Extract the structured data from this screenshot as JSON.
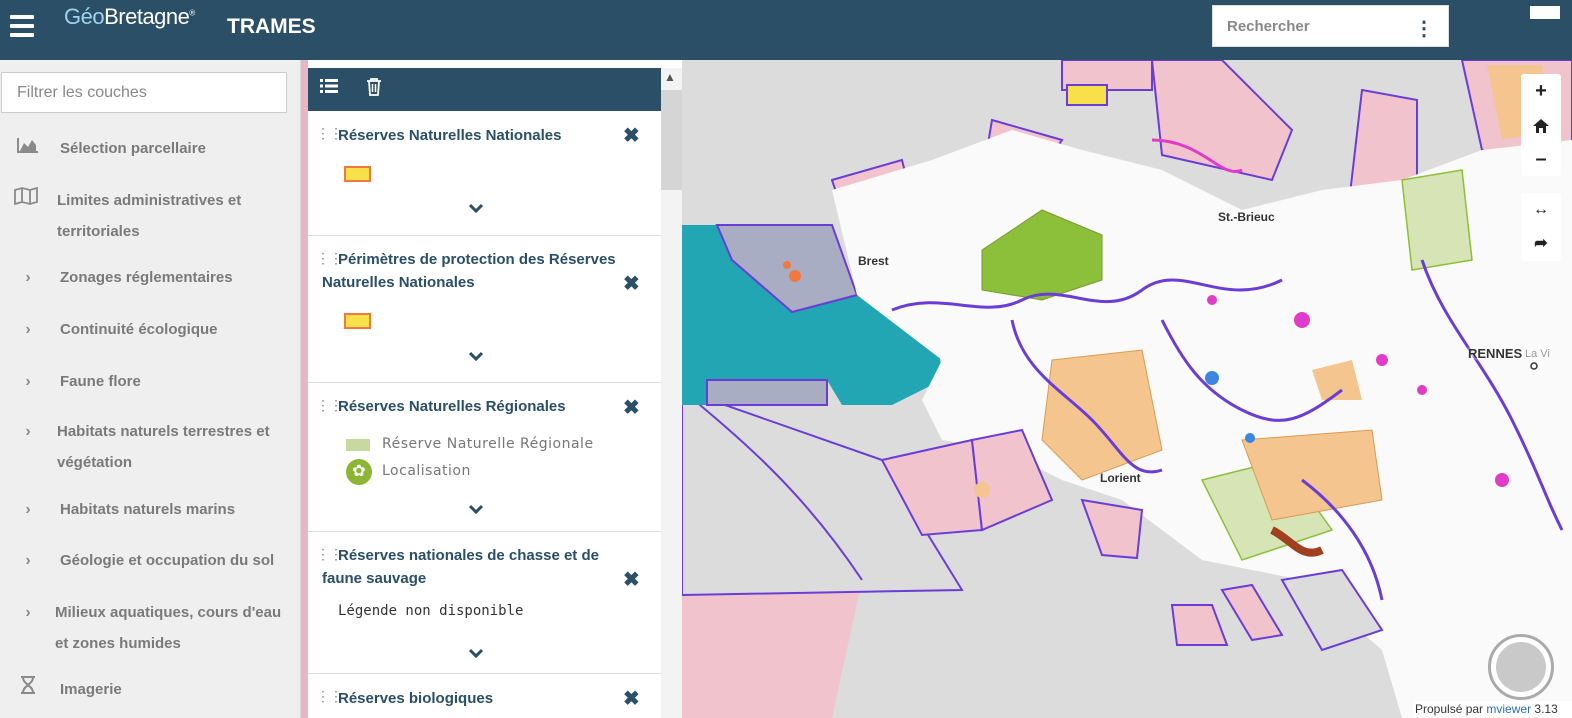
{
  "header": {
    "logo_geo": "Géo",
    "logo_bretagne": "Bretagne",
    "logo_reg": "®",
    "title": "TRAMES",
    "search_placeholder": "Rechercher"
  },
  "sidebar": {
    "filter_placeholder": "Filtrer les couches",
    "items": [
      {
        "label": "Sélection parcellaire",
        "icon": "area-chart-icon"
      },
      {
        "label": "Limites administratives et territoriales",
        "icon": "map-icon"
      },
      {
        "label": "Zonages réglementaires",
        "icon": "chevron-right-icon"
      },
      {
        "label": "Continuité écologique",
        "icon": "chevron-right-icon"
      },
      {
        "label": "Faune flore",
        "icon": "chevron-right-icon"
      },
      {
        "label": "Habitats naturels terrestres et végétation",
        "icon": "chevron-right-icon"
      },
      {
        "label": "Habitats naturels marins",
        "icon": "chevron-right-icon"
      },
      {
        "label": "Géologie et occupation du sol",
        "icon": "chevron-right-icon"
      },
      {
        "label": "Milieux aquatiques, cours d'eau et zones humides",
        "icon": "chevron-right-icon"
      },
      {
        "label": "Imagerie",
        "icon": "hourglass-icon"
      }
    ]
  },
  "layers": [
    {
      "title": "Réserves Naturelles Nationales"
    },
    {
      "title": "Périmètres de protection des Réserves Naturelles Nationales"
    },
    {
      "title": "Réserves Naturelles Régionales",
      "legend": [
        "Réserve Naturelle Régionale",
        "Localisation"
      ]
    },
    {
      "title": "Réserves nationales de chasse et de faune sauvage",
      "no_legend": "Légende non disponible"
    },
    {
      "title": "Réserves biologiques"
    }
  ],
  "map": {
    "cities": [
      "Brest",
      "St.-Brieuc",
      "RENNES",
      "Lorient"
    ],
    "city_suffix": "La Vi",
    "attribution_prefix": "Propulsé par",
    "attribution_link": "mviewer",
    "attribution_version": "3.13"
  },
  "colors": {
    "header": "#2a4f66",
    "sidebar": "#efefef",
    "reserve_fill": "#f7e04a",
    "reserve_stroke": "#f07a3e",
    "regional_green": "#b7cf7e",
    "sea_teal": "#22a6b3",
    "violet": "#6a3dd6",
    "magenta": "#e03cc8",
    "pink_zone": "#f2c6cf",
    "orange_zone": "#f4c58f"
  }
}
